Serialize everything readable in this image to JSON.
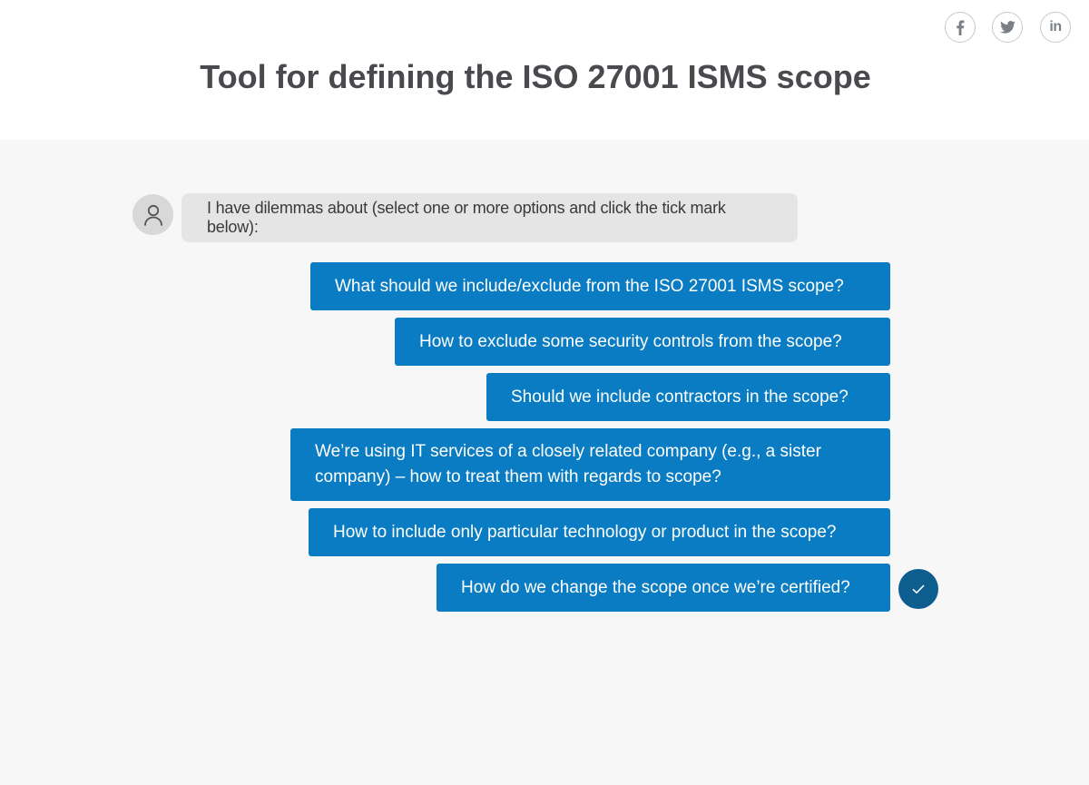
{
  "header": {
    "title": "Tool for defining the ISO 27001 ISMS scope",
    "social": [
      {
        "icon": "facebook-icon"
      },
      {
        "icon": "twitter-icon"
      },
      {
        "icon": "linkedin-icon",
        "glyph": "in"
      }
    ]
  },
  "chat": {
    "avatar_icon": "user-icon",
    "question": "I have dilemmas about (select one or more options and click the tick mark below):",
    "options": [
      {
        "label": "What should we include/exclude from the ISO 27001 ISMS scope?"
      },
      {
        "label": "How to exclude some security controls from the scope?"
      },
      {
        "label": "Should we include contractors in the scope?"
      },
      {
        "label": "We’re using IT services of a closely related company (e.g., a sister company) – how to treat them with regards to scope?"
      },
      {
        "label": "How to include only particular technology or product in the scope?"
      },
      {
        "label": "How do we change the scope once we’re certified?"
      }
    ],
    "confirm_icon": "checkmark-icon"
  },
  "colors": {
    "option_bg": "#0a7cc3",
    "confirm_bg": "#0e5d8f",
    "chat_bg": "#f7f7f7",
    "question_bg": "#e5e5e5",
    "title_color": "#4a4a4e"
  }
}
